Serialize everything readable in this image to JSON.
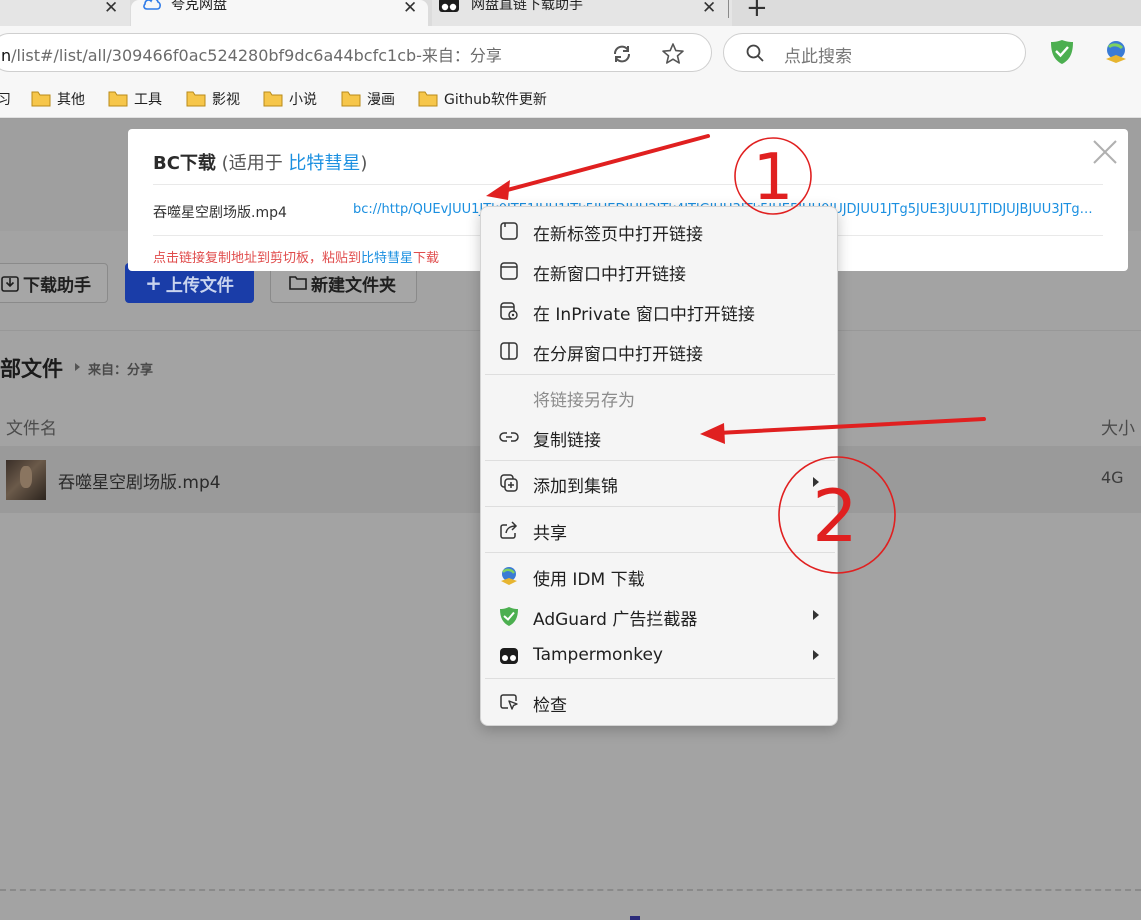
{
  "browser": {
    "tabs": [
      {
        "label": "",
        "active": false
      },
      {
        "label": "夸克网盘",
        "active": true
      },
      {
        "label": "网盘直链下载助手",
        "active": false
      }
    ],
    "new_tab_label": "+",
    "close_glyph": "✕",
    "address": {
      "host_suffix": "n",
      "path": "/list#/list/all/309466f0ac524280bf9dc6a44bcfc1cb-来自：分享"
    },
    "search_placeholder": "点此搜索",
    "extensions": [
      "adguard-icon",
      "idm-icon"
    ],
    "bookmarks": [
      {
        "label": "习",
        "has_folder": false
      },
      {
        "label": "其他",
        "has_folder": true
      },
      {
        "label": "工具",
        "has_folder": true
      },
      {
        "label": "影视",
        "has_folder": true
      },
      {
        "label": "小说",
        "has_folder": true
      },
      {
        "label": "漫画",
        "has_folder": true
      },
      {
        "label": "Github软件更新",
        "has_folder": true
      }
    ]
  },
  "page": {
    "buttons": {
      "download_helper": "下载助手",
      "upload": "上传文件",
      "new_folder": "新建文件夹"
    },
    "breadcrumb": {
      "title": "部文件",
      "source": "来自：分享"
    },
    "columns": {
      "name": "文件名",
      "size": "大小"
    },
    "files": [
      {
        "name": "吞噬星空剧场版.mp4",
        "size": "4G"
      }
    ]
  },
  "bc_panel": {
    "title": "BC下载",
    "subtitle_prefix": "(适用于 ",
    "subtitle_app": "比特彗星",
    "subtitle_suffix": ")",
    "file_name": "吞噬星空剧场版.mp4",
    "link": "bc://http/QUEvJUU1JTk0JTE1JUU1JTk5JUEDJUU2JTk4JTlGJUU3JTk5JUE5JUU0JUJDJUU1JTg5JUE3JUU1JTlDJUJBJUU3JTg5JT...",
    "hint_prefix": "点击链接复制地址到剪切板，粘贴到",
    "hint_app": "比特彗星",
    "hint_suffix": "下载"
  },
  "context_menu": {
    "items": [
      {
        "label": "在新标签页中打开链接",
        "icon": "new-tab-icon",
        "submenu": false,
        "disabled": false
      },
      {
        "label": "在新窗口中打开链接",
        "icon": "new-window-icon",
        "submenu": false,
        "disabled": false
      },
      {
        "label": "在 InPrivate 窗口中打开链接",
        "icon": "inprivate-icon",
        "submenu": false,
        "disabled": false
      },
      {
        "label": "在分屏窗口中打开链接",
        "icon": "split-screen-icon",
        "submenu": false,
        "disabled": false
      },
      {
        "label": "将链接另存为",
        "icon": "",
        "submenu": false,
        "disabled": true
      },
      {
        "label": "复制链接",
        "icon": "link-icon",
        "submenu": false,
        "disabled": false
      },
      {
        "label": "添加到集锦",
        "icon": "collections-icon",
        "submenu": true,
        "disabled": false
      },
      {
        "label": "共享",
        "icon": "share-icon",
        "submenu": false,
        "disabled": false
      },
      {
        "label": "使用 IDM 下载",
        "icon": "idm-icon",
        "submenu": false,
        "disabled": false
      },
      {
        "label": "AdGuard 广告拦截器",
        "icon": "adguard-icon",
        "submenu": true,
        "disabled": false
      },
      {
        "label": "Tampermonkey",
        "icon": "tampermonkey-icon",
        "submenu": true,
        "disabled": false
      },
      {
        "label": "检查",
        "icon": "inspect-icon",
        "submenu": false,
        "disabled": false
      }
    ]
  },
  "annotations": {
    "step1": "1",
    "step2": "2"
  },
  "colors": {
    "accent_blue": "#1a8fe0",
    "hint_red": "#e04c4c",
    "annotation_red": "#e02020",
    "upload_blue": "#1a3da8"
  }
}
